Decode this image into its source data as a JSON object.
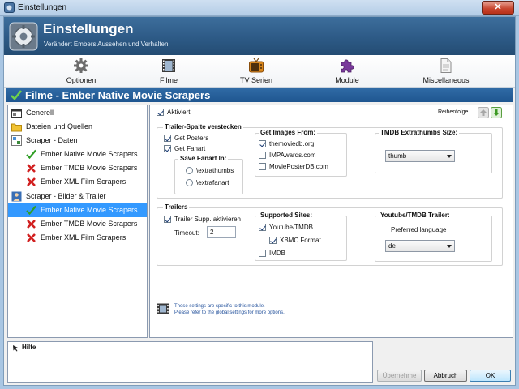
{
  "window": {
    "title": "Einstellungen",
    "close_glyph": "✕"
  },
  "header": {
    "title": "Einstellungen",
    "subtitle": "Verändert Embers Aussehen und Verhalten"
  },
  "toolbar": [
    {
      "label": "Optionen",
      "icon": "gear-icon"
    },
    {
      "label": "Filme",
      "icon": "film-icon"
    },
    {
      "label": "TV Serien",
      "icon": "tv-icon"
    },
    {
      "label": "Module",
      "icon": "puzzle-icon"
    },
    {
      "label": "Miscellaneous",
      "icon": "document-icon"
    }
  ],
  "section": {
    "title": "Filme - Ember Native Movie Scrapers"
  },
  "tree": [
    {
      "label": "Generell",
      "icon": "settings-window-icon"
    },
    {
      "label": "Dateien und Quellen",
      "icon": "folder-icon"
    },
    {
      "label": "Scraper - Daten",
      "icon": "scraper-icon"
    },
    {
      "label": "Ember Native Movie Scrapers",
      "icon": "checkmark-icon"
    },
    {
      "label": "Ember TMDB Movie Scrapers",
      "icon": "cross-icon"
    },
    {
      "label": "Ember XML Film Scrapers",
      "icon": "cross-icon"
    },
    {
      "label": "Scraper - Bilder & Trailer",
      "icon": "people-icon"
    },
    {
      "label": "Ember Native Movie Scrapers",
      "icon": "checkmark-icon",
      "selected": true
    },
    {
      "label": "Ember TMDB Movie Scrapers",
      "icon": "cross-icon"
    },
    {
      "label": "Ember XML Film Scrapers",
      "icon": "cross-icon"
    }
  ],
  "panel": {
    "enabled_label": "Aktiviert",
    "enabled": true,
    "order_label": "Reihenfolge",
    "trailer_group": {
      "title": "Trailer-Spalte verstecken",
      "get_posters": "Get Posters",
      "get_fanart": "Get Fanart",
      "save_fanart_title": "Save Fanart In:",
      "extrathumbs": "\\extrathumbs",
      "extrafanart": "\\extrafanart"
    },
    "images_group": {
      "title": "Get Images From:",
      "themoviedb": "themoviedb.org",
      "impawards": "IMPAwards.com",
      "movieposterdb": "MoviePosterDB.com"
    },
    "extrathumbs_group": {
      "title": "TMDB Extrathumbs Size:",
      "value": "thumb"
    },
    "trailers_group": {
      "title": "Trailers",
      "support": "Trailer Supp. aktivieren",
      "timeout_label": "Timeout:",
      "timeout_value": "2"
    },
    "sites_group": {
      "title": "Supported Sites:",
      "youtube": "Youtube/TMDB",
      "xbmc": "XBMC Format",
      "imdb": "IMDB"
    },
    "youtube_group": {
      "title": "Youtube/TMDB Trailer:",
      "pref_label": "Preferred language",
      "value": "de"
    },
    "note_line1": "These settings are specific to this module.",
    "note_line2": "Please refer to the global settings for more options."
  },
  "help": {
    "label": "Hilfe"
  },
  "buttons": {
    "apply": "Übernehme",
    "cancel": "Abbruch",
    "ok": "OK"
  },
  "colors": {
    "header": "#2d5a86",
    "section": "#2a63a0",
    "selection": "#3399ff",
    "note_text": "#1f4e9a"
  }
}
